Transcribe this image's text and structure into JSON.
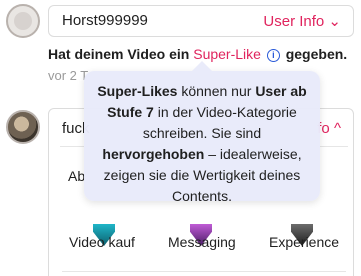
{
  "comments": [
    {
      "username": "Horst999999",
      "user_info_label": "User Info",
      "chevron": "chevron-down-icon"
    },
    {
      "username": "fuck",
      "user_info_label": "fo",
      "chevron": "chevron-up-icon"
    }
  ],
  "notification": {
    "text_prefix": "Hat deinem Video ein ",
    "superlike": "Super-Like",
    "text_suffix": " gegeben.",
    "timestamp": "vor 2 T"
  },
  "tooltip": {
    "t1": "Super-Likes",
    "t2": " können nur ",
    "t3": "User ab Stufe 7",
    "t4": " in der Video-Kategorie schreiben. Sie sind ",
    "t5": "hervorgehoben",
    "t6": " – idealerweise, zeigen sie die Wertigkeit deines Contents."
  },
  "panel": {
    "heading": "Ab",
    "categories": [
      {
        "label": "Video kauf",
        "icon": "teal-badge-icon"
      },
      {
        "label": "Messaging",
        "icon": "purple-badge-icon"
      },
      {
        "label": "Experience",
        "icon": "dark-badge-icon"
      }
    ]
  },
  "colors": {
    "accent": "#e0245e",
    "info": "#2a5ad8",
    "tooltip_bg": "#e8eafa"
  }
}
